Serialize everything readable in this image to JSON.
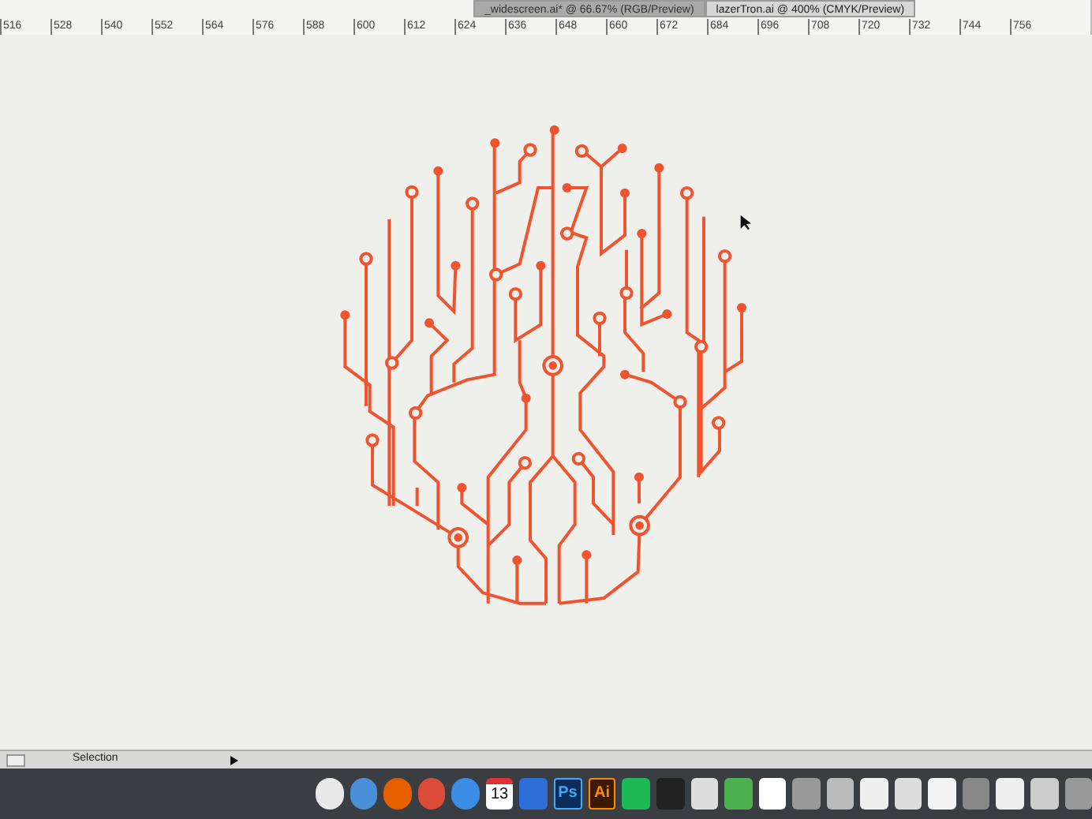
{
  "document_tabs": [
    {
      "title": "_widescreen.ai* @ 66.67% (RGB/Preview)",
      "selected": false
    },
    {
      "title": "lazerTron.ai @ 400% (CMYK/Preview)",
      "selected": true
    }
  ],
  "ruler": {
    "ticks": [
      "516",
      "528",
      "540",
      "552",
      "564",
      "576",
      "588",
      "600",
      "612",
      "624",
      "636",
      "648",
      "660",
      "672",
      "684",
      "696",
      "708",
      "720",
      "732",
      "744",
      "756"
    ]
  },
  "status_bar": {
    "tool": "Selection"
  },
  "dock": {
    "calendar_day": "13",
    "photoshop_label": "Ps",
    "illustrator_label": "Ai"
  }
}
